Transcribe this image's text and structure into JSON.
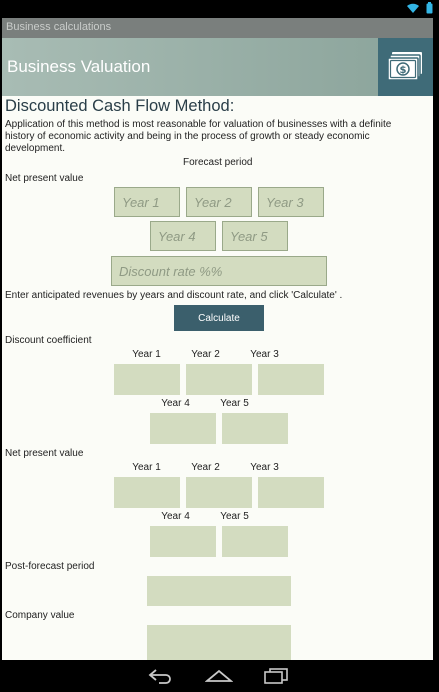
{
  "titlebar": {
    "title": "Business calculations"
  },
  "header": {
    "title": "Business Valuation",
    "logo_icon": "money-bill-icon",
    "accent": "#3f6b78"
  },
  "section": {
    "title": "Discounted Cash Flow Method:",
    "intro": "Application of this method is most reasonable for valuation of businesses with a definite history of economic activity and being in the process of growth or steady economic development."
  },
  "forecast_period_label": "Forecast period",
  "npv_label": "Net present value",
  "inputs": {
    "year1": "Year 1",
    "year2": "Year 2",
    "year3": "Year 3",
    "year4": "Year 4",
    "year5": "Year 5",
    "discount_rate": "Discount rate %%"
  },
  "instruction": "Enter anticipated revenues by years and discount rate, and click 'Calculate' .",
  "calculate_label": "Calculate",
  "discount_coefficient": {
    "label": "Discount coefficient",
    "years": [
      "Year 1",
      "Year 2",
      "Year 3",
      "Year 4",
      "Year 5"
    ]
  },
  "net_present_value": {
    "label": "Net present value",
    "years": [
      "Year 1",
      "Year 2",
      "Year 3",
      "Year 4",
      "Year 5"
    ]
  },
  "post_forecast_label": "Post-forecast period",
  "company_value_label": "Company value"
}
